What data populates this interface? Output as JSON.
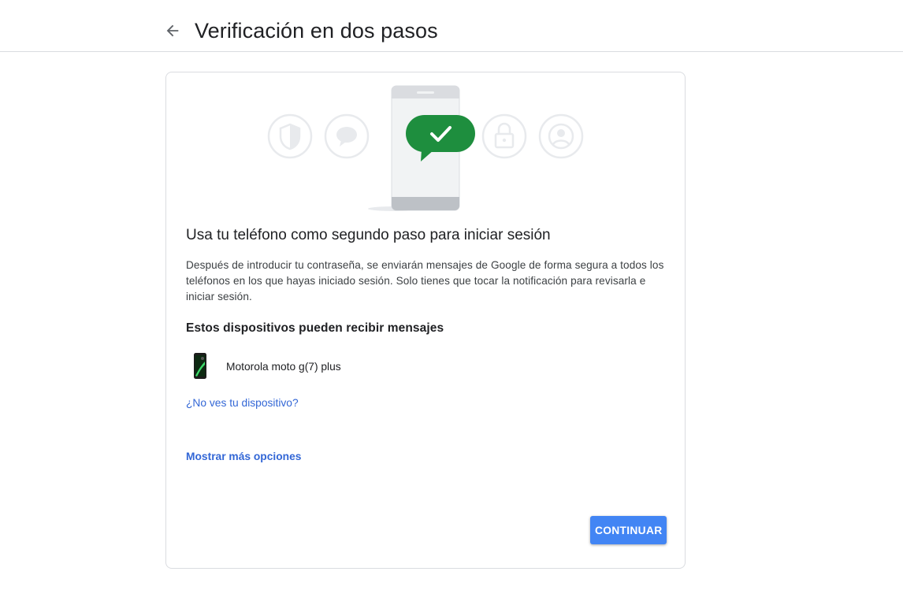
{
  "header": {
    "back_icon": "arrow-back-icon",
    "title": "Verificación en dos pasos"
  },
  "card": {
    "illustration_icons": [
      "shield-icon",
      "chat-bubble-icon",
      "phone-icon",
      "checkmark-bubble-icon",
      "lock-icon",
      "account-icon"
    ],
    "title": "Usa tu teléfono como segundo paso para iniciar sesión",
    "description": "Después de introducir tu contraseña, se enviarán mensajes de Google de forma segura a todos los teléfonos en los que hayas iniciado sesión. Solo tienes que tocar la notificación para revisarla e iniciar sesión.",
    "devices_heading": "Estos dispositivos pueden recibir mensajes",
    "devices": [
      {
        "name": "Motorola moto g(7) plus",
        "icon": "smartphone-icon"
      }
    ],
    "missing_device_link": "¿No ves tu dispositivo?",
    "more_options_link": "Mostrar más opciones",
    "continue_label": "CONTINUAR"
  },
  "colors": {
    "accent": "#4285f4",
    "link": "#3367d6",
    "success": "#1e8e3e",
    "border": "#dadce0"
  }
}
